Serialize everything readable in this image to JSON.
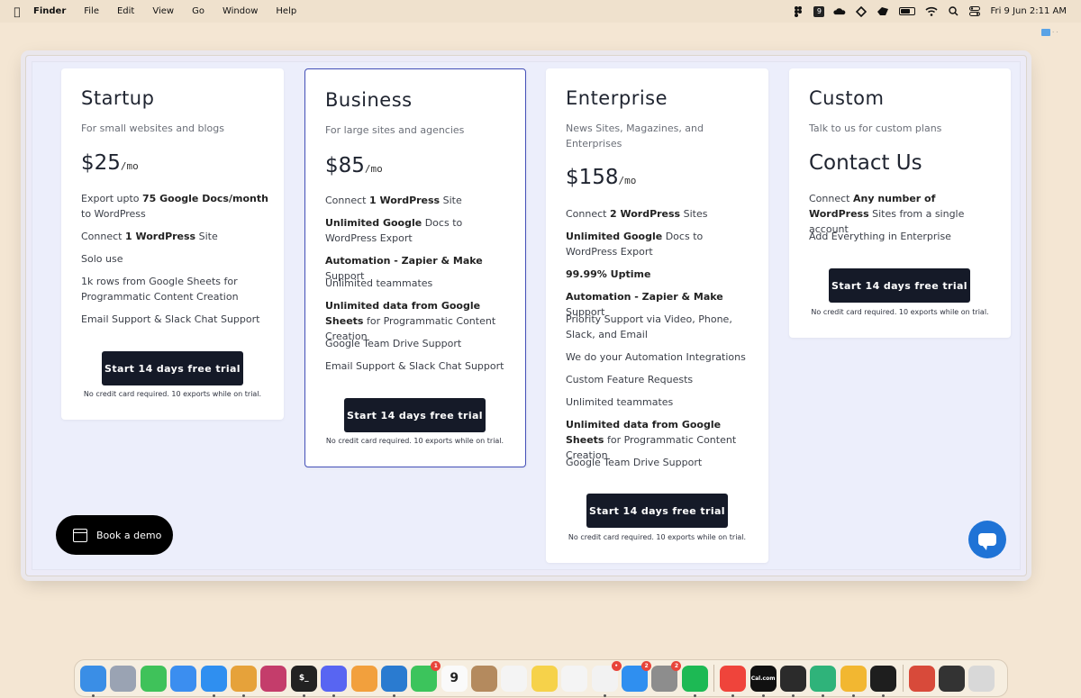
{
  "menubar": {
    "apple_icon": "apple-icon",
    "app_name": "Finder",
    "menus": [
      "File",
      "Edit",
      "View",
      "Go",
      "Window",
      "Help"
    ],
    "status_icons": [
      "figma-icon",
      "notification-9-icon",
      "cloud-icon",
      "dropbox-icon",
      "mountain-icon",
      "battery-icon",
      "wifi-icon",
      "search-icon",
      "control-center-icon"
    ],
    "notification_count": "9",
    "clock": "Fri 9 Jun  2:11 AM"
  },
  "pricing": {
    "plans": [
      {
        "name": "Startup",
        "description": "For small websites and blogs",
        "price": "$25",
        "price_unit": "/mo",
        "features": [
          [
            "Export upto ",
            "75 Google Docs/month",
            " to WordPress"
          ],
          [
            "Connect ",
            "1 WordPress",
            " Site"
          ],
          [
            "Solo use",
            "",
            ""
          ],
          [
            "1k rows from Google Sheets for Programmatic Content Creation",
            "",
            ""
          ],
          [
            "Email Support & Slack Chat Support",
            "",
            ""
          ]
        ],
        "cta": "Start 14 days free trial",
        "note": "No credit card required. 10 exports while on trial."
      },
      {
        "name": "Business",
        "description": "For large sites and agencies",
        "price": "$85",
        "price_unit": "/mo",
        "features": [
          [
            "Connect ",
            "1 WordPress",
            " Site"
          ],
          [
            "",
            "Unlimited Google",
            " Docs to WordPress Export"
          ],
          [
            "",
            "Automation - Zapier & Make",
            " Support"
          ],
          [
            "Unlimited teammates",
            "",
            ""
          ],
          [
            "",
            "Unlimited data from Google Sheets",
            " for Programmatic Content Creation"
          ],
          [
            "Google Team Drive Support",
            "",
            ""
          ],
          [
            "Email Support & Slack Chat Support",
            "",
            ""
          ]
        ],
        "cta": "Start 14 days free trial",
        "note": "No credit card required. 10 exports while on trial."
      },
      {
        "name": "Enterprise",
        "description": "News Sites, Magazines, and Enterprises",
        "price": "$158",
        "price_unit": "/mo",
        "features": [
          [
            "Connect ",
            "2 WordPress",
            " Sites"
          ],
          [
            "",
            "Unlimited Google",
            " Docs to WordPress Export"
          ],
          [
            "",
            "99.99% Uptime",
            ""
          ],
          [
            "",
            "Automation - Zapier & Make",
            " Support"
          ],
          [
            "Priority Support via Video, Phone, Slack, and Email",
            "",
            ""
          ],
          [
            "We do your Automation Integrations",
            "",
            ""
          ],
          [
            "Custom Feature Requests",
            "",
            ""
          ],
          [
            "Unlimited teammates",
            "",
            ""
          ],
          [
            "",
            "Unlimited data from Google Sheets",
            " for Programmatic Content Creation"
          ],
          [
            "Google Team Drive Support",
            "",
            ""
          ]
        ],
        "cta": "Start 14 days free trial",
        "note": "No credit card required. 10 exports while on trial."
      },
      {
        "name": "Custom",
        "description": "Talk to us for custom plans",
        "price": "Contact Us",
        "price_unit": "",
        "features": [
          [
            "Connect ",
            "Any number of WordPress",
            " Sites from a single account"
          ],
          [
            "Add Everything in Enterprise",
            "",
            ""
          ]
        ],
        "cta": "Start 14 days free trial",
        "note": "No credit card required. 10 exports while on trial."
      }
    ],
    "book_demo": "Book a demo",
    "chat_icon": "chat-icon"
  },
  "dock": {
    "apps": [
      {
        "name": "finder",
        "color": "#3a8ee6",
        "label": "",
        "badge": "",
        "running": true
      },
      {
        "name": "launchpad",
        "color": "#9aa3b3",
        "label": "",
        "badge": "",
        "running": false
      },
      {
        "name": "messages",
        "color": "#3fc25a",
        "label": "",
        "badge": "",
        "running": false
      },
      {
        "name": "mail",
        "color": "#3b8ef0",
        "label": "",
        "badge": "",
        "running": false
      },
      {
        "name": "safari",
        "color": "#2f8ff0",
        "label": "",
        "badge": "",
        "running": true
      },
      {
        "name": "chrome",
        "color": "#e6a23a",
        "label": "",
        "badge": "",
        "running": true
      },
      {
        "name": "affinity",
        "color": "#c43d6b",
        "label": "",
        "badge": "",
        "running": false
      },
      {
        "name": "terminal",
        "color": "#222222",
        "label": "$_",
        "badge": "",
        "running": true
      },
      {
        "name": "discord",
        "color": "#5865f2",
        "label": "",
        "badge": "",
        "running": true
      },
      {
        "name": "photos",
        "color": "#f2a03d",
        "label": "",
        "badge": "",
        "running": false
      },
      {
        "name": "vscode",
        "color": "#2a7bd0",
        "label": "",
        "badge": "",
        "running": true
      },
      {
        "name": "facetime",
        "color": "#3cc45c",
        "label": "",
        "badge": "1",
        "running": false
      },
      {
        "name": "calendar",
        "color": "#fafafa",
        "label": "9",
        "badge": "",
        "running": false
      },
      {
        "name": "contacts",
        "color": "#b48a5e",
        "label": "",
        "badge": "",
        "running": false
      },
      {
        "name": "reminders",
        "color": "#f4f4f4",
        "label": "",
        "badge": "",
        "running": false
      },
      {
        "name": "notes",
        "color": "#f6d24a",
        "label": "",
        "badge": "",
        "running": false
      },
      {
        "name": "freeform",
        "color": "#f4f4f4",
        "label": "",
        "badge": "",
        "running": false
      },
      {
        "name": "slack",
        "color": "#f2f2f2",
        "label": "",
        "badge": "•",
        "running": true
      },
      {
        "name": "app-store",
        "color": "#2f8ff0",
        "label": "",
        "badge": "2",
        "running": false
      },
      {
        "name": "system-settings",
        "color": "#8d8d8d",
        "label": "",
        "badge": "2",
        "running": false
      },
      {
        "name": "spotify",
        "color": "#1db954",
        "label": "",
        "badge": "",
        "running": true
      },
      {
        "name": "anydesk",
        "color": "#ef443b",
        "label": "",
        "badge": "",
        "running": true
      },
      {
        "name": "cal-com",
        "color": "#111111",
        "label": "Cal.com",
        "badge": "",
        "running": true
      },
      {
        "name": "activity-monitor",
        "color": "#2b2b2b",
        "label": "",
        "badge": "",
        "running": true
      },
      {
        "name": "perplexity",
        "color": "#2fb37a",
        "label": "",
        "badge": "",
        "running": true
      },
      {
        "name": "cyberduck",
        "color": "#f2b731",
        "label": "",
        "badge": "",
        "running": true
      },
      {
        "name": "figma",
        "color": "#1e1e1e",
        "label": "",
        "badge": "",
        "running": true
      },
      {
        "name": "recent-doc",
        "color": "#d84a3a",
        "label": "",
        "badge": "",
        "running": false
      },
      {
        "name": "screen-recording",
        "color": "#333333",
        "label": "",
        "badge": "",
        "running": false
      },
      {
        "name": "trash",
        "color": "#d8d8d8",
        "label": "",
        "badge": "",
        "running": false
      }
    ]
  }
}
